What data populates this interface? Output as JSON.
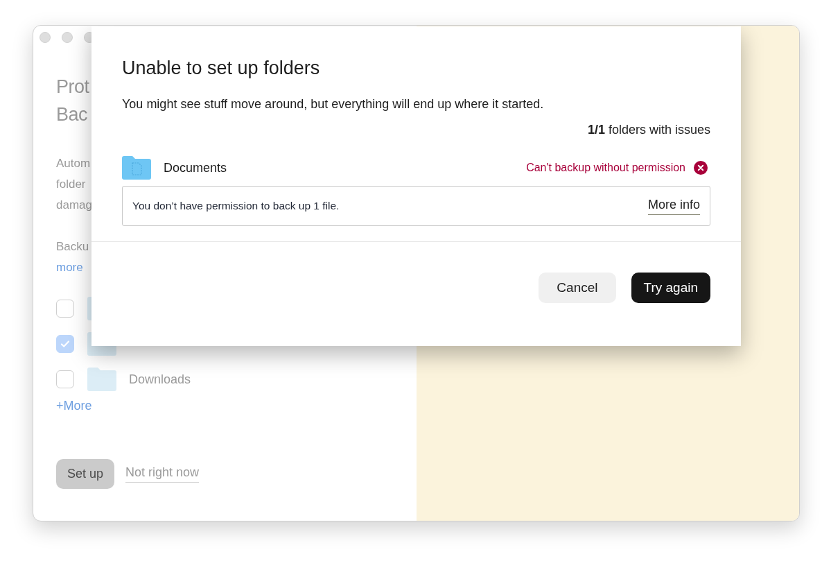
{
  "background": {
    "title_lines": [
      "Prot",
      "Bac"
    ],
    "description_lines": [
      "Autom",
      "folder",
      "damag"
    ],
    "note_lines": [
      "Backu"
    ],
    "note_link": "more",
    "folders": [
      {
        "checked": false
      },
      {
        "checked": true
      },
      {
        "label": "Downloads",
        "checked": false
      }
    ],
    "more_link": "+More",
    "setup_button": "Set up",
    "later_link": "Not right now"
  },
  "dialog": {
    "title": "Unable to set up folders",
    "message": "You might see stuff move around, but everything will end up where it started.",
    "summary": "**1/1** folders with issues",
    "folders": [
      {
        "name": "Documents",
        "status": "Can't backup without permission",
        "detail": "You don’t have permission to back up 1 file.",
        "action": "More info"
      }
    ],
    "buttons": [
      {
        "label": "Cancel",
        "kind": "secondary"
      },
      {
        "label": "Try again",
        "kind": "primary"
      }
    ]
  }
}
